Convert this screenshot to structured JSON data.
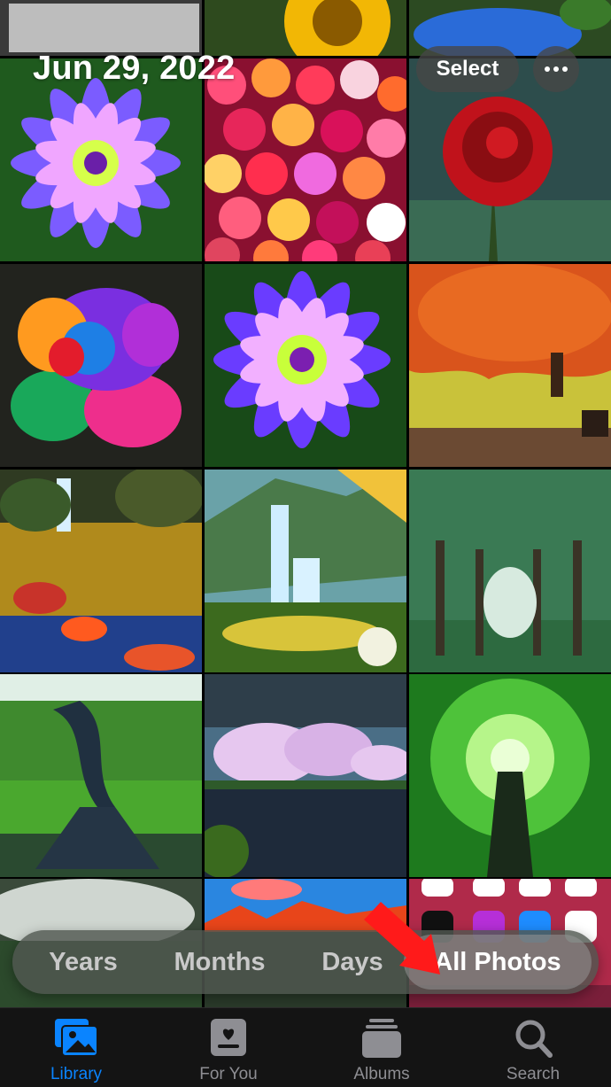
{
  "header": {
    "date": "Jun 29, 2022",
    "select_label": "Select",
    "more_icon": "ellipsis-icon"
  },
  "grid": {
    "photos": [
      "flower",
      "flower",
      "flower",
      "flower",
      "flower",
      "autumn-tree",
      "waterfall",
      "waterfall",
      "forest",
      "tree",
      "pink-trees",
      "forest",
      "mist",
      "mountains",
      "phone-screenshot"
    ]
  },
  "segments": {
    "items": [
      {
        "label": "Years"
      },
      {
        "label": "Months"
      },
      {
        "label": "Days"
      },
      {
        "label": "All Photos"
      }
    ],
    "selected": "All Photos"
  },
  "annotation": {
    "arrow_color": "#ff1a1a"
  },
  "tabbar": {
    "items": [
      {
        "label": "Library",
        "icon": "photo-library-icon"
      },
      {
        "label": "For You",
        "icon": "for-you-icon"
      },
      {
        "label": "Albums",
        "icon": "albums-icon"
      },
      {
        "label": "Search",
        "icon": "search-icon"
      }
    ],
    "active_color": "#0a84ff",
    "inactive_color": "#8e8e93"
  }
}
